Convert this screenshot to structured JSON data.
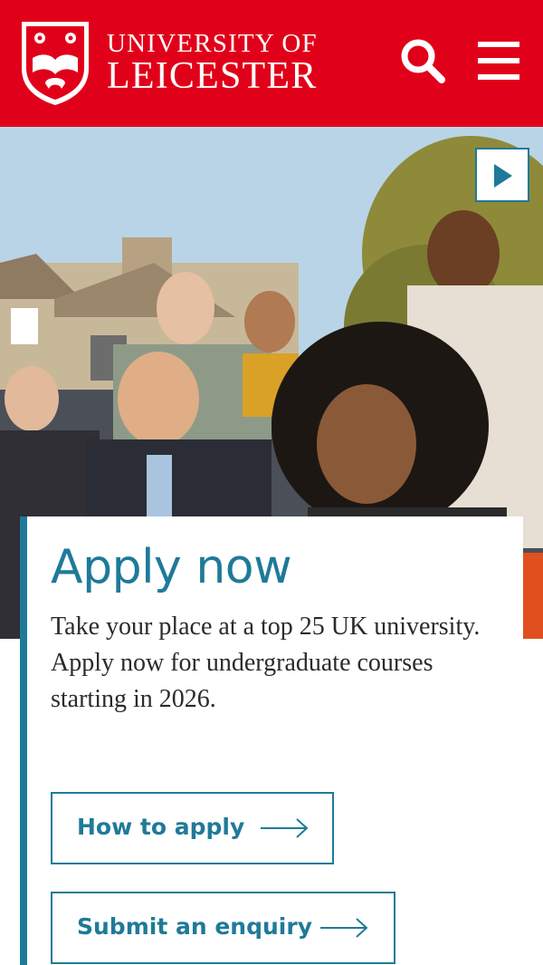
{
  "header": {
    "brand_line1": "UNIVERSITY OF",
    "brand_line2": "LEICESTER",
    "search_icon": "search-icon",
    "menu_icon": "hamburger-menu-icon",
    "brand_color": "#e1001a"
  },
  "hero": {
    "play_icon": "play-icon"
  },
  "card": {
    "title": "Apply now",
    "text": "Take your place at a top 25 UK university. Apply now for undergraduate courses starting in 2026.",
    "buttons": [
      {
        "label": "How to apply",
        "icon": "arrow-right-icon"
      },
      {
        "label": "Submit an enquiry",
        "icon": "arrow-right-icon"
      }
    ],
    "accent_color": "#1f7a99"
  }
}
